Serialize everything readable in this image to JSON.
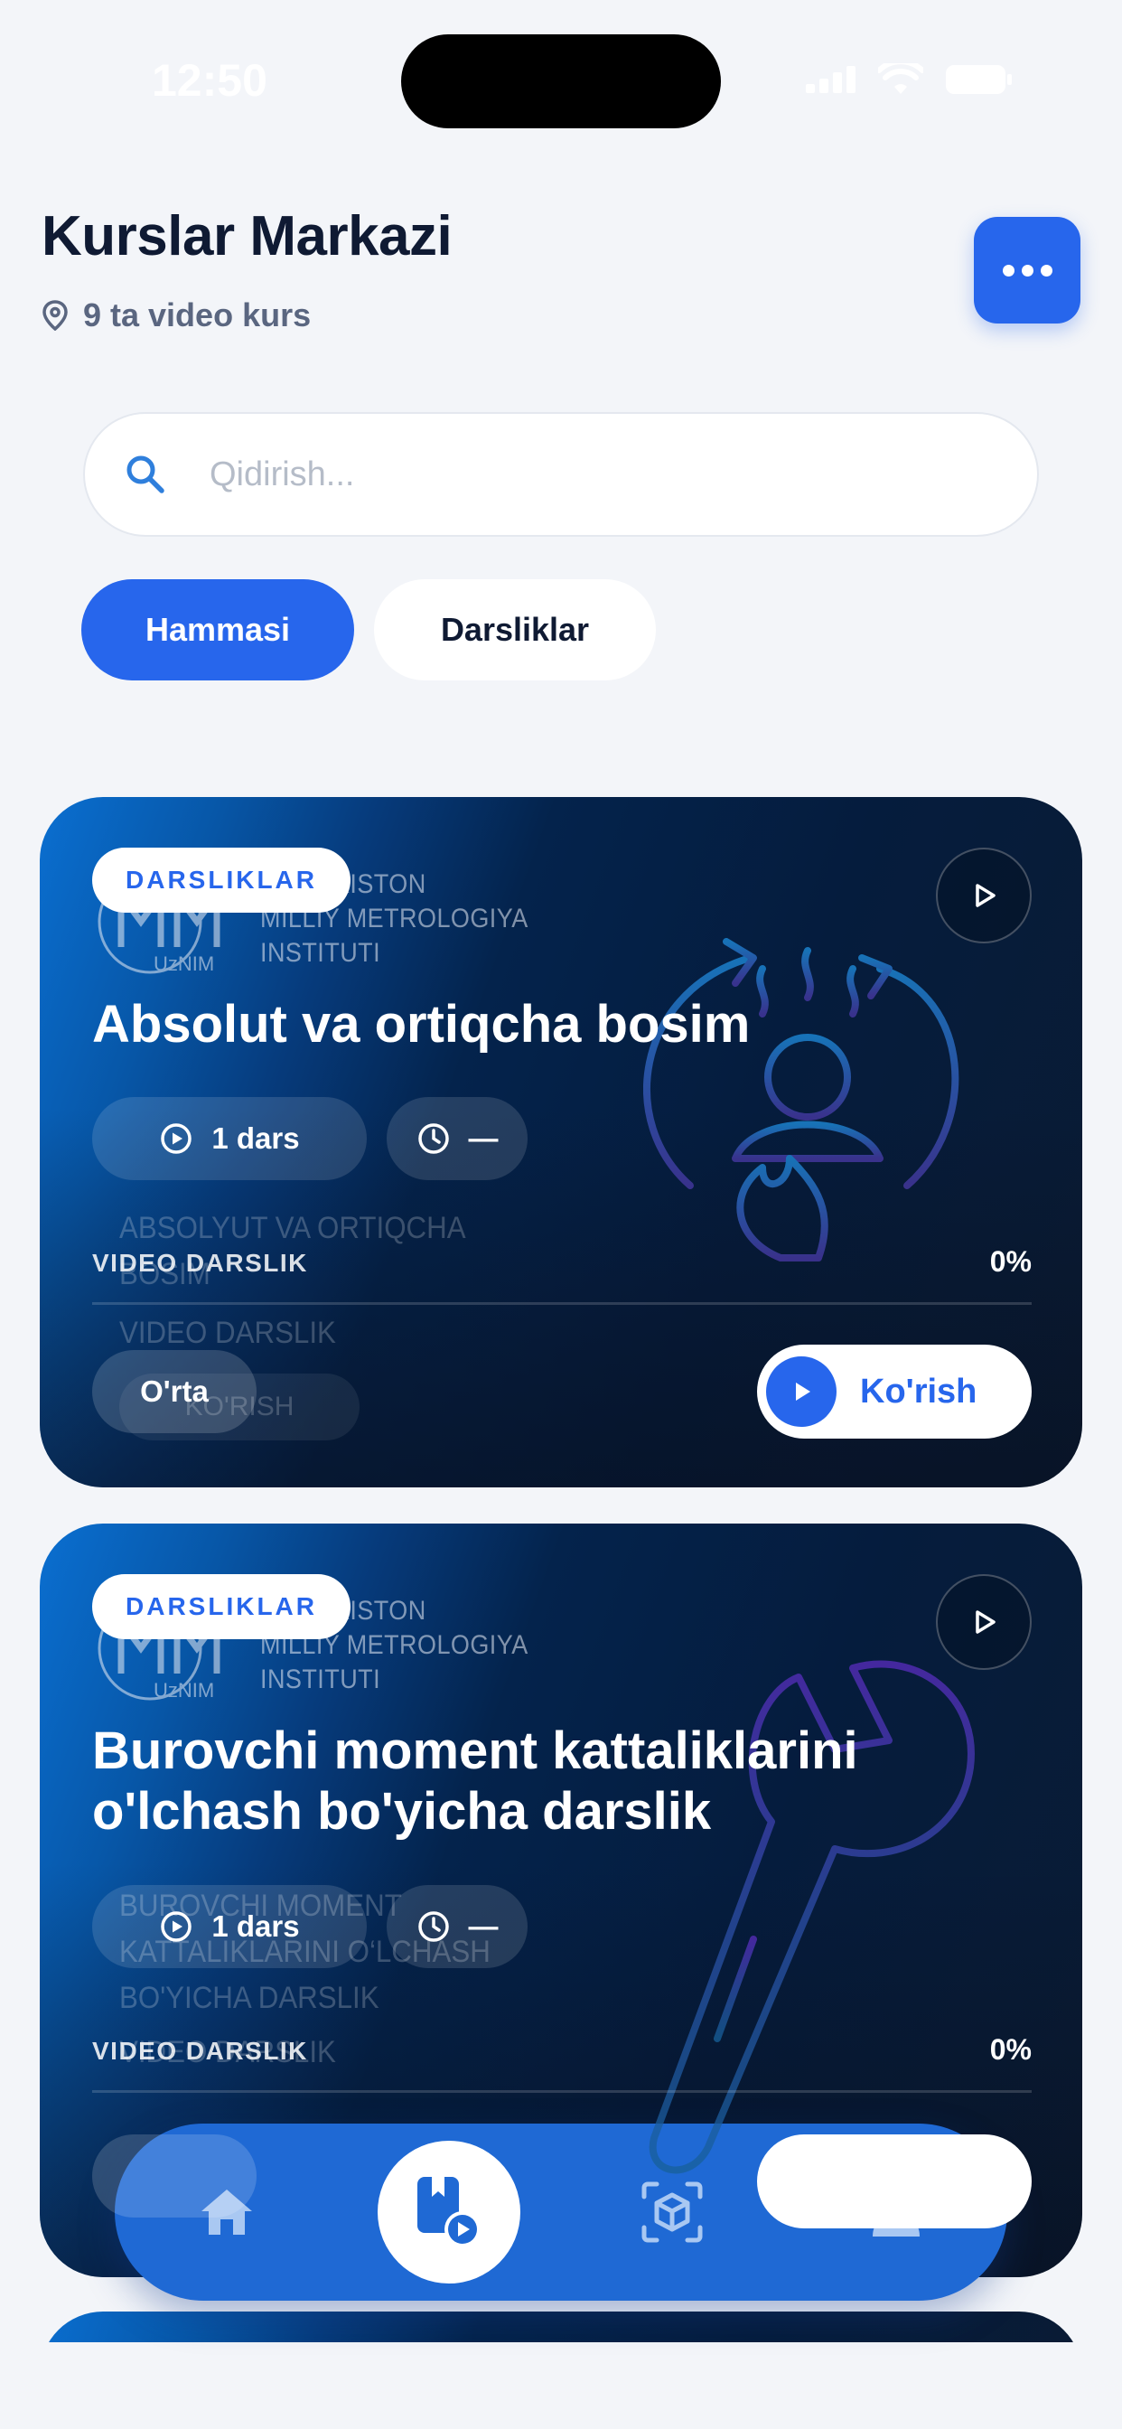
{
  "status_bar": {
    "time": "12:50"
  },
  "header": {
    "title": "Kurslar Markazi",
    "subtitle": "9 ta video kurs"
  },
  "search": {
    "placeholder": "Qidirish..."
  },
  "filters": [
    {
      "label": "Hammasi",
      "active": true
    },
    {
      "label": "Darsliklar",
      "active": false
    }
  ],
  "institute_logo": {
    "monogram": "UzNIM",
    "lines": [
      "O'ZBEKISTON",
      "MILLIY METROLOGIYA",
      "INSTITUTI"
    ]
  },
  "courses": [
    {
      "category": "DARSLIKLAR",
      "title": "Absolut va ortiqcha bosim",
      "lessons": "1 dars",
      "duration": "—",
      "type_label": "VIDEO DARSLIK",
      "progress": "0%",
      "progress_value": 0,
      "level": "O'rta",
      "watch_label": "Ko'rish",
      "illustration": "pressure-icon",
      "preview_text": {
        "title": "ABSOLYUT VA ORTIQCHA BOSIM",
        "type": "VIDEO DARSLIK",
        "button": "KO'RISH"
      }
    },
    {
      "category": "DARSLIKLAR",
      "title": "Burovchi moment kattaliklarini o'lchash bo'yicha darslik",
      "lessons": "1 dars",
      "duration": "—",
      "type_label": "VIDEO DARSLIK",
      "progress": "0%",
      "progress_value": 0,
      "illustration": "wrench-icon",
      "preview_text": {
        "title": "BUROVCHI MOMENT KATTALIKLARINI O‘LCHASH BO'YICHA DARSLIK",
        "type": "VIDEO DARSLIK"
      }
    }
  ],
  "bottom_nav": [
    {
      "name": "home",
      "icon": "home-icon",
      "active": false
    },
    {
      "name": "courses",
      "icon": "video-book-icon",
      "active": true
    },
    {
      "name": "ar",
      "icon": "ar-cube-icon",
      "active": false
    },
    {
      "name": "profile",
      "icon": "user-icon",
      "active": false
    }
  ],
  "colors": {
    "accent": "#2766ec",
    "background": "#f3f5f9",
    "nav": "#1f69d4",
    "card_dark": "#051c3d",
    "card_light": "#0a6fd1"
  }
}
